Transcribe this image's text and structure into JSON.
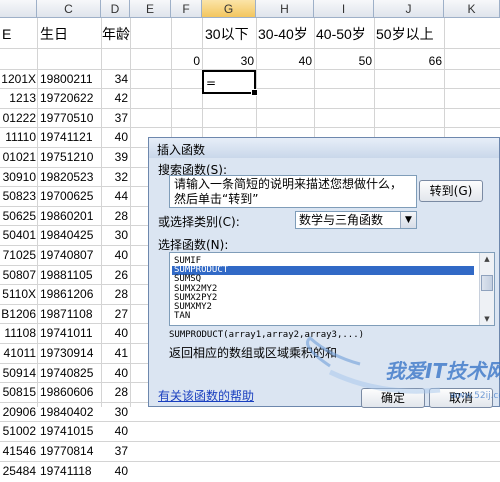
{
  "sheet": {
    "columns": [
      "C",
      "D",
      "E",
      "F",
      "G",
      "H",
      "I",
      "J",
      "K"
    ],
    "header_row": {
      "col_b": "E",
      "col_c": "生日",
      "col_d": "年龄",
      "g": "30以下",
      "h": "30-40岁",
      "i": "40-50岁",
      "j": "50岁以上"
    },
    "stats_row": {
      "f": "0",
      "g": "30",
      "h": "40",
      "i": "50",
      "j": "66"
    },
    "active_cell_value": "=",
    "rows": [
      {
        "id": "1201X",
        "birth": "19800211",
        "age": "34"
      },
      {
        "id": "1213",
        "birth": "19720622",
        "age": "42"
      },
      {
        "id": "01222",
        "birth": "19770510",
        "age": "37"
      },
      {
        "id": "11110",
        "birth": "19741121",
        "age": "40"
      },
      {
        "id": "01021",
        "birth": "19751210",
        "age": "39"
      },
      {
        "id": "30910",
        "birth": "19820523",
        "age": "32"
      },
      {
        "id": "50823",
        "birth": "19700625",
        "age": "44"
      },
      {
        "id": "50625",
        "birth": "19860201",
        "age": "28"
      },
      {
        "id": "50401",
        "birth": "19840425",
        "age": "30"
      },
      {
        "id": "71025",
        "birth": "19740807",
        "age": "40"
      },
      {
        "id": "50807",
        "birth": "19881105",
        "age": "26"
      },
      {
        "id": "5110X",
        "birth": "19861206",
        "age": "28"
      },
      {
        "id": "B1206",
        "birth": "19871108",
        "age": "27"
      },
      {
        "id": "11108",
        "birth": "19741011",
        "age": "40"
      },
      {
        "id": "41011",
        "birth": "19730914",
        "age": "41"
      },
      {
        "id": "50914",
        "birth": "19740825",
        "age": "40"
      },
      {
        "id": "50815",
        "birth": "19860606",
        "age": "28"
      },
      {
        "id": "20906",
        "birth": "19840402",
        "age": "30"
      },
      {
        "id": "51002",
        "birth": "19741015",
        "age": "40"
      },
      {
        "id": "41546",
        "birth": "19770814",
        "age": "37"
      },
      {
        "id": "25484",
        "birth": "19741118",
        "age": "40"
      }
    ]
  },
  "dialog": {
    "title": "插入函数",
    "search_label": "搜索函数(S):",
    "search_value": "请输入一条简短的说明来描述您想做什么，然后单击“转到”",
    "goto_button": "转到(G)",
    "category_label": "或选择类别(C):",
    "category_value": "数学与三角函数",
    "select_label": "选择函数(N):",
    "functions": [
      "SUMIF",
      "SUMPRODUCT",
      "SUMSQ",
      "SUMX2MY2",
      "SUMX2PY2",
      "SUMXMY2",
      "TAN"
    ],
    "selected_function": "SUMPRODUCT",
    "syntax": "SUMPRODUCT(array1,array2,array3,...)",
    "description": "返回相应的数组或区域乘积的和",
    "help_link": "有关该函数的帮助",
    "ok_button": "确定",
    "cancel_button": "取消"
  },
  "watermark": {
    "text": "我爱IT技术网",
    "url": "www.52ij.com"
  },
  "colors": {
    "selection": "#3169c6",
    "dialog_bg": "#dbe5f2",
    "header_selected": "#f3c65f",
    "link": "#1a3fbf"
  }
}
